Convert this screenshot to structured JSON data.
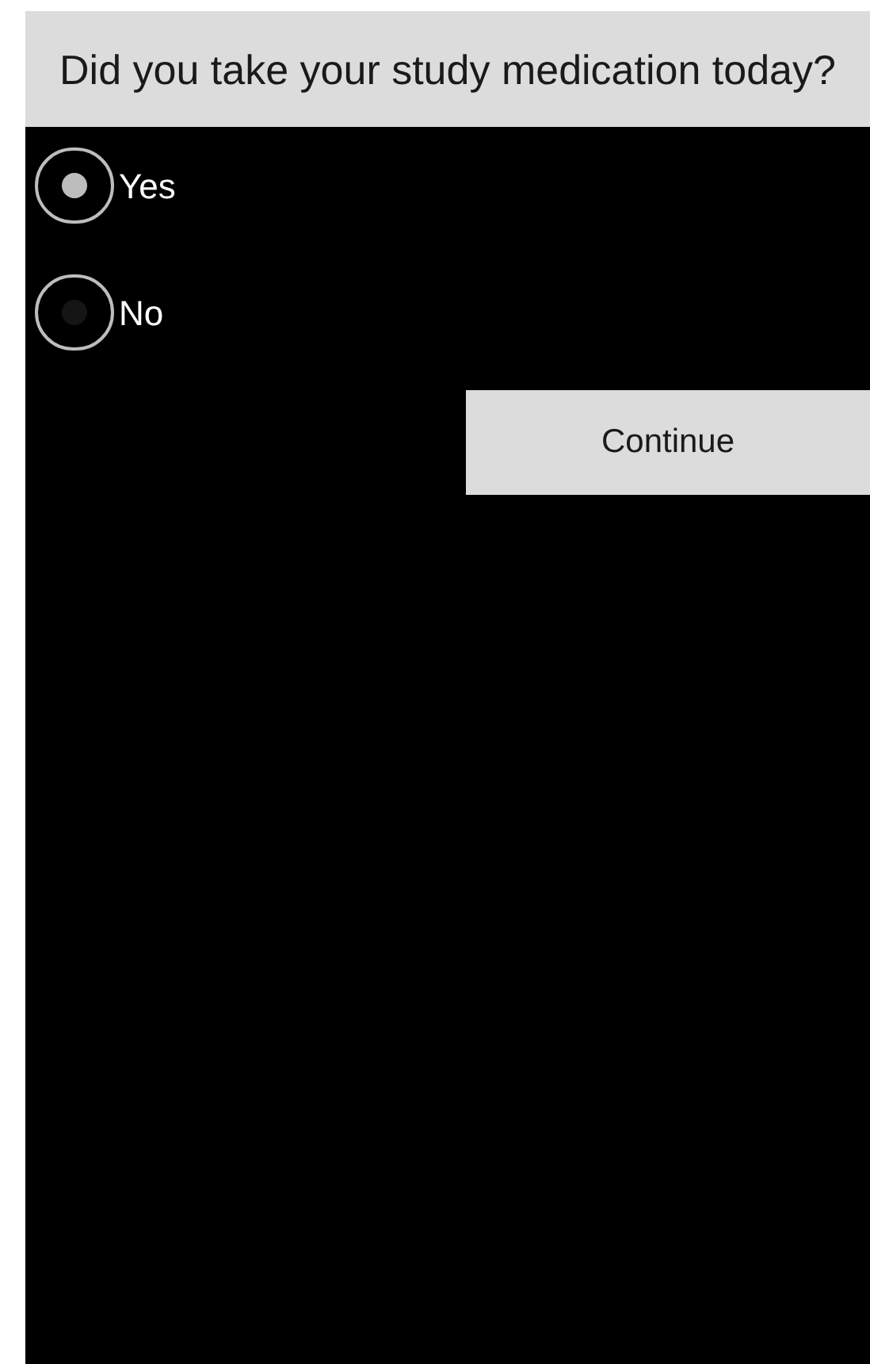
{
  "question": "Did you take your study medication today?",
  "options": [
    {
      "label": "Yes",
      "selected": true
    },
    {
      "label": "No",
      "selected": false
    }
  ],
  "button": "Continue"
}
